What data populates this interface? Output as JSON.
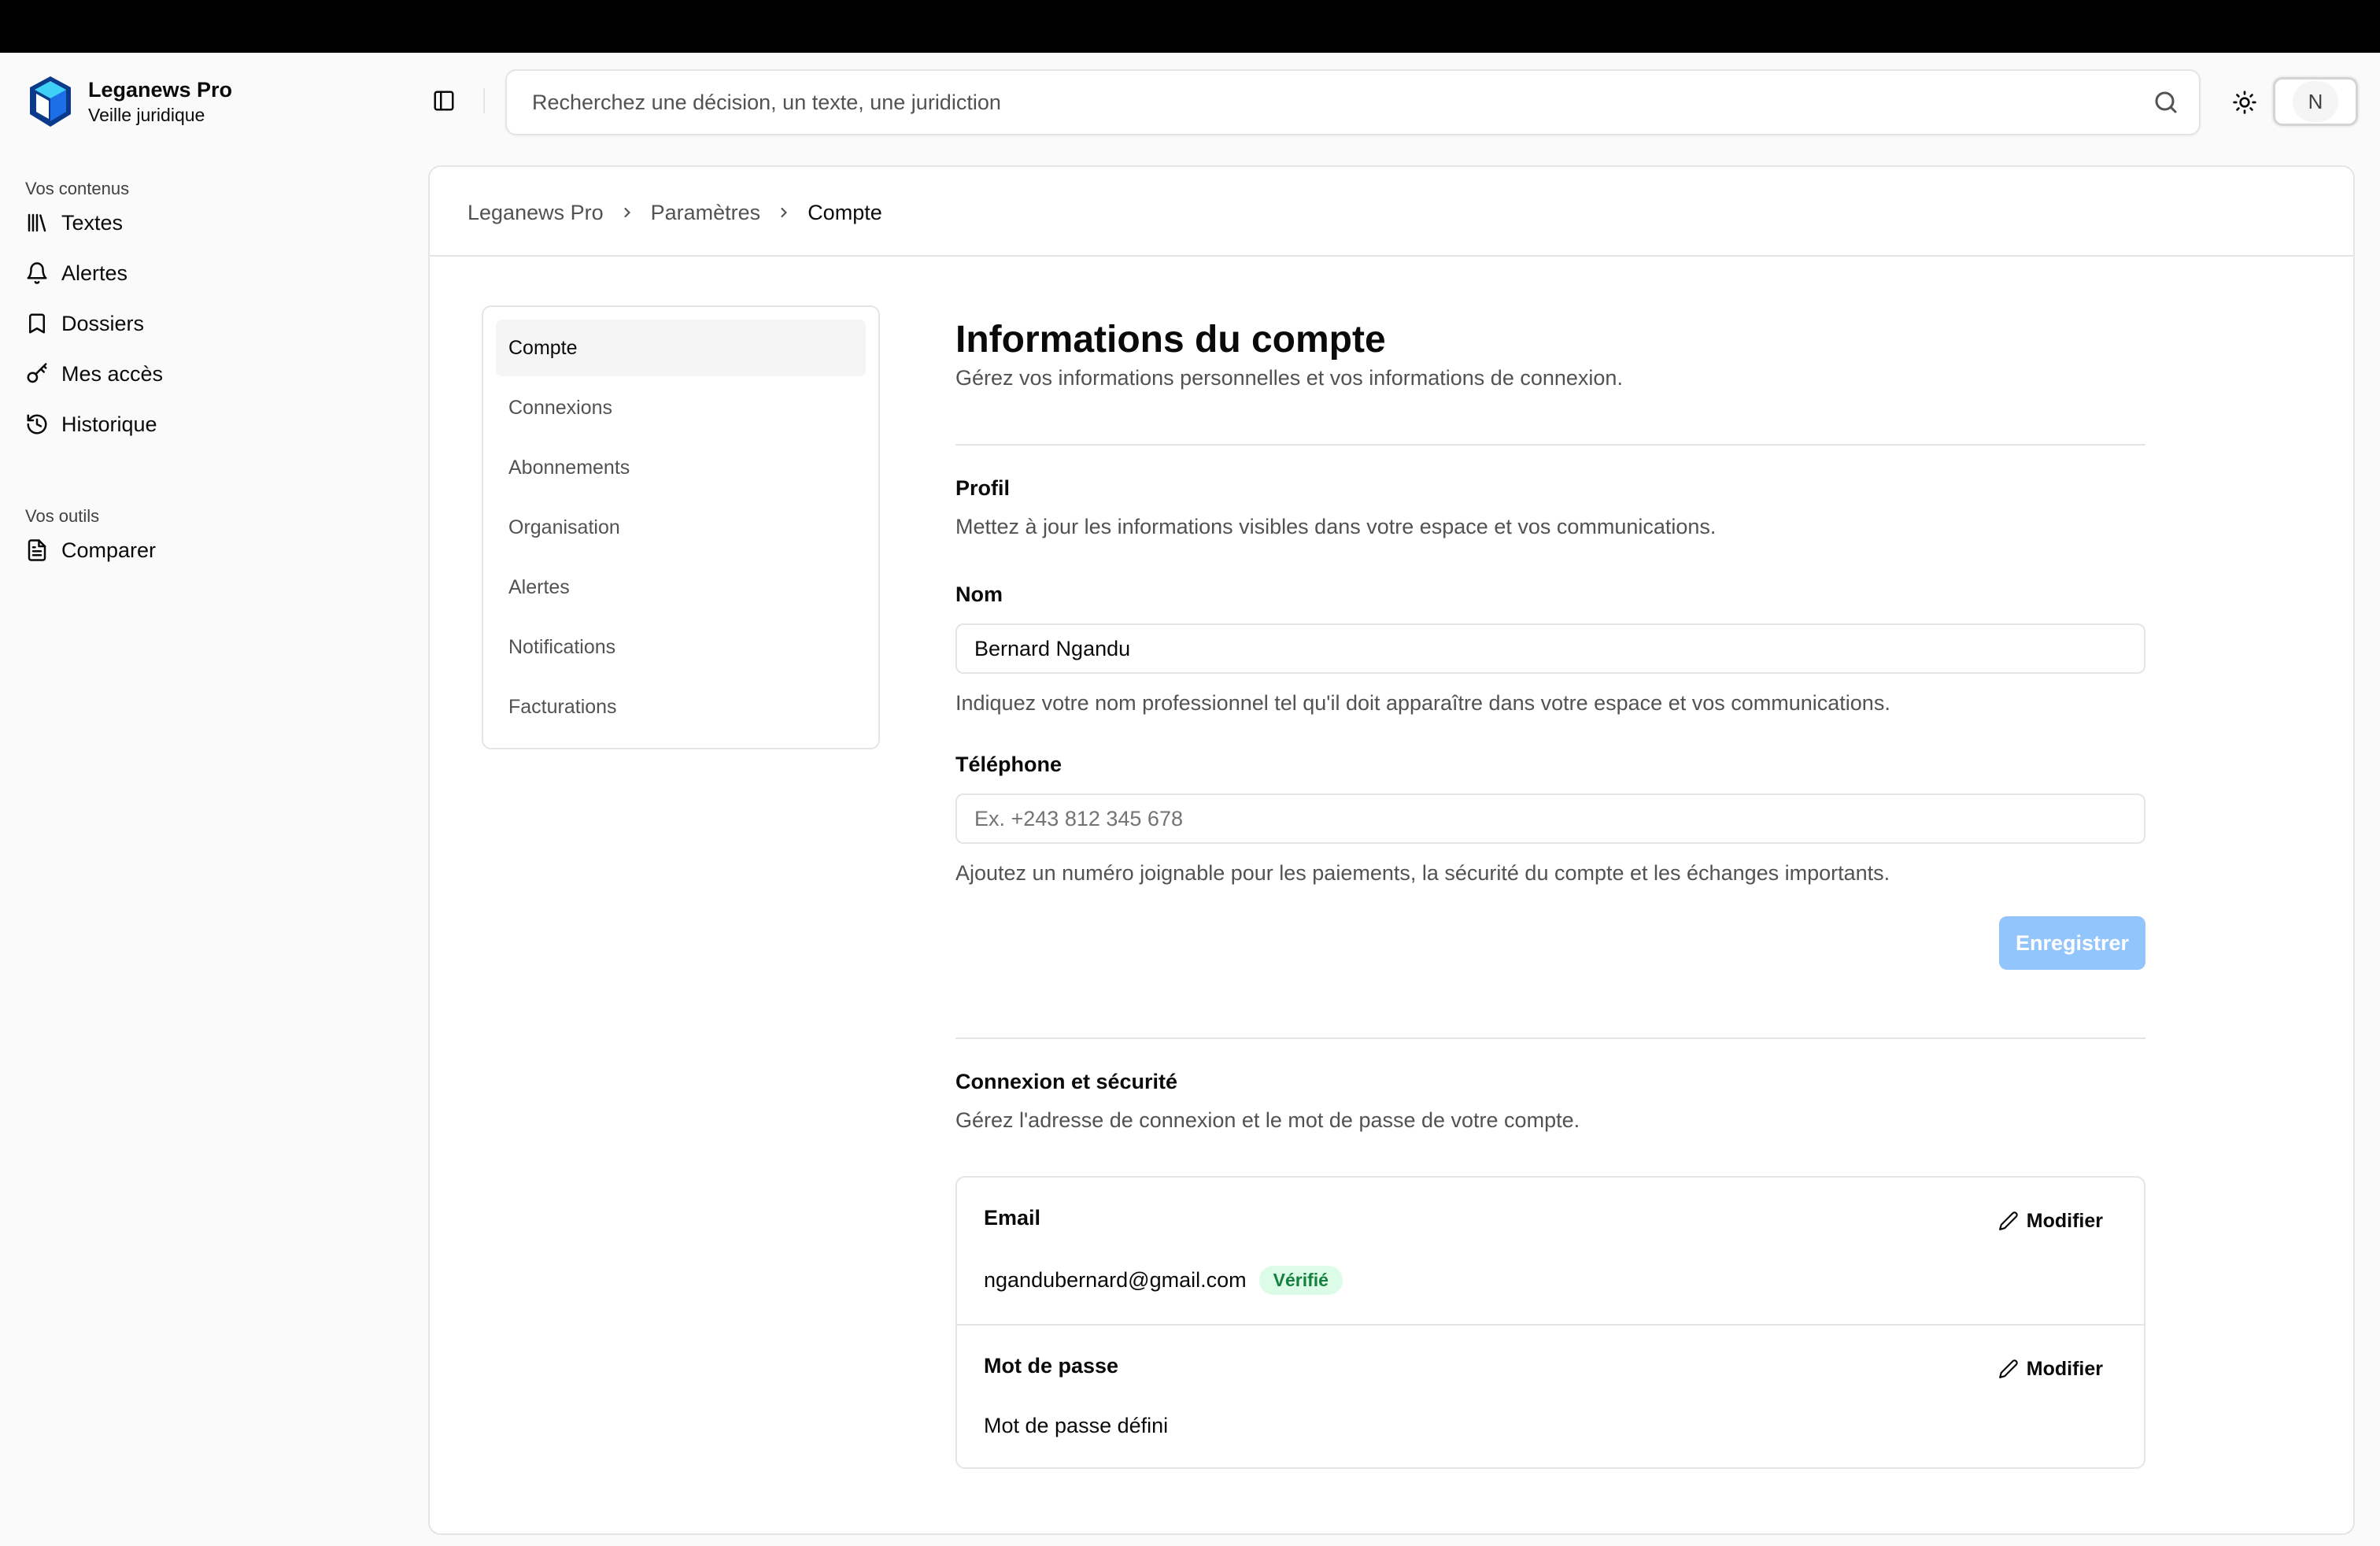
{
  "brand": {
    "name": "Leganews Pro",
    "subtitle": "Veille juridique"
  },
  "sidebar": {
    "groups": [
      {
        "label": "Vos contenus",
        "items": [
          {
            "label": "Textes",
            "icon": "library-icon"
          },
          {
            "label": "Alertes",
            "icon": "bell-icon"
          },
          {
            "label": "Dossiers",
            "icon": "bookmark-icon"
          },
          {
            "label": "Mes accès",
            "icon": "key-icon"
          },
          {
            "label": "Historique",
            "icon": "history-icon"
          }
        ]
      },
      {
        "label": "Vos outils",
        "items": [
          {
            "label": "Comparer",
            "icon": "file-text-icon"
          }
        ]
      }
    ]
  },
  "header": {
    "search_placeholder": "Recherchez une décision, un texte, une juridiction",
    "avatar_initial": "N"
  },
  "breadcrumb": [
    "Leganews Pro",
    "Paramètres",
    "Compte"
  ],
  "settings_nav": [
    "Compte",
    "Connexions",
    "Abonnements",
    "Organisation",
    "Alertes",
    "Notifications",
    "Facturations"
  ],
  "settings_nav_active": "Compte",
  "page": {
    "title": "Informations du compte",
    "subtitle": "Gérez vos informations personnelles et vos informations de connexion."
  },
  "profile": {
    "title": "Profil",
    "description": "Mettez à jour les informations visibles dans votre espace et vos communications.",
    "name_label": "Nom",
    "name_value": "Bernard Ngandu",
    "name_help": "Indiquez votre nom professionnel tel qu'il doit apparaître dans votre espace et vos communications.",
    "phone_label": "Téléphone",
    "phone_value": "",
    "phone_placeholder": "Ex. +243 812 345 678",
    "phone_help": "Ajoutez un numéro joignable pour les paiements, la sécurité du compte et les échanges importants.",
    "save_label": "Enregistrer"
  },
  "security": {
    "title": "Connexion et sécurité",
    "description": "Gérez l'adresse de connexion et le mot de passe de votre compte.",
    "email_label": "Email",
    "email_value": "ngandubernard@gmail.com",
    "email_badge": "Vérifié",
    "password_label": "Mot de passe",
    "password_value": "Mot de passe défini",
    "modify_label": "Modifier"
  },
  "colors": {
    "accent_disabled": "#93c5fd",
    "badge_bg": "#dcfce7",
    "badge_text": "#15803d",
    "border": "#e5e5e5"
  }
}
